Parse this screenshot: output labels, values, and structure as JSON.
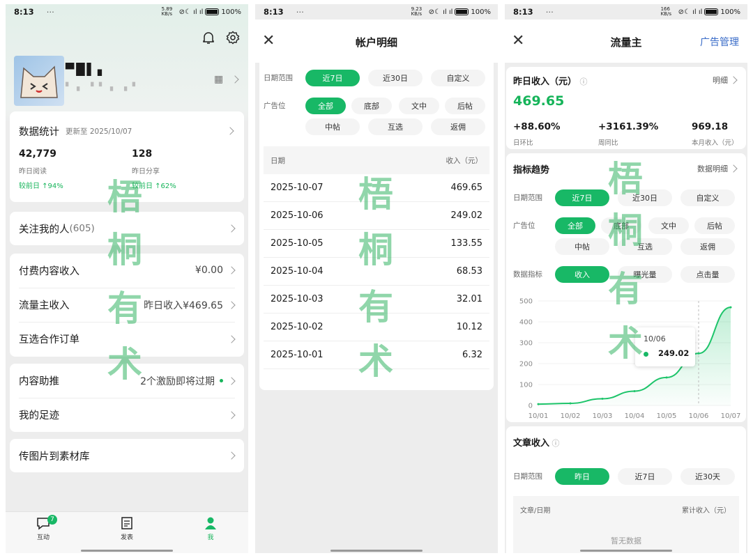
{
  "status": {
    "time": "8:13",
    "dots": "⋯",
    "net1": "5.89 KB/s",
    "net2": "9.23 KB/s",
    "net3": "166 KB/s",
    "battery": "100%"
  },
  "profile": {
    "name": "▀█▌▖",
    "subtext": "▘ ▖ ▝ ▘ ▖ ▗ ▘"
  },
  "stats": {
    "title": "数据统计",
    "updated": "更新至 2025/10/07",
    "reads": {
      "value": "42,779",
      "label": "昨日阅读",
      "change": "较前日 ↑94%"
    },
    "shares": {
      "value": "128",
      "label": "昨日分享",
      "change": "较前日 ↑62%"
    }
  },
  "followers": {
    "label": "关注我的人",
    "count": "(605)"
  },
  "menu": {
    "paid": {
      "label": "付费内容收入",
      "value": "¥0.00"
    },
    "traffic": {
      "label": "流量主收入",
      "value": "昨日收入¥469.65"
    },
    "mutual": {
      "label": "互选合作订单"
    },
    "assist": {
      "label": "内容助推",
      "value": "2个激励即将过期"
    },
    "footprint": {
      "label": "我的足迹"
    },
    "upload": {
      "label": "传图片到素材库"
    }
  },
  "nav": {
    "interact": "互动",
    "badge": "7",
    "post": "发表",
    "me": "我"
  },
  "watermark": {
    "c1": "梧",
    "c2": "桐",
    "c3": "有",
    "c4": "术"
  },
  "account": {
    "title": "帐户明细",
    "date_range_label": "日期范围",
    "date_opts": [
      "近7日",
      "近30日",
      "自定义"
    ],
    "ad_label": "广告位",
    "ad_opts": [
      "全部",
      "底部",
      "文中",
      "后帖",
      "中帖",
      "互选",
      "返佣"
    ],
    "col_date": "日期",
    "col_income": "收入（元）",
    "rows": [
      {
        "date": "2025-10-07",
        "amount": "469.65"
      },
      {
        "date": "2025-10-06",
        "amount": "249.02"
      },
      {
        "date": "2025-10-05",
        "amount": "133.55"
      },
      {
        "date": "2025-10-04",
        "amount": "68.53"
      },
      {
        "date": "2025-10-03",
        "amount": "32.01"
      },
      {
        "date": "2025-10-02",
        "amount": "10.12"
      },
      {
        "date": "2025-10-01",
        "amount": "6.32"
      }
    ]
  },
  "traffic": {
    "title": "流量主",
    "ad_manage": "广告管理",
    "yesterday_label": "昨日收入（元）",
    "detail": "明细",
    "yesterday_value": "469.65",
    "m1": {
      "value": "+88.60%",
      "label": "日环比"
    },
    "m2": {
      "value": "+3161.39%",
      "label": "周同比"
    },
    "m3": {
      "value": "969.18",
      "label": "本月收入（元）"
    },
    "trend_title": "指标趋势",
    "trend_detail": "数据明细",
    "date_label": "日期范围",
    "date_opts": [
      "近7日",
      "近30日",
      "自定义"
    ],
    "ad_label": "广告位",
    "ad_opts": [
      "全部",
      "底部",
      "文中",
      "后帖",
      "中帖",
      "互选",
      "返佣"
    ],
    "metric_label": "数据指标",
    "metric_opts": [
      "收入",
      "曝光量",
      "点击量"
    ],
    "tooltip_date": "10/06",
    "tooltip_value": "249.02",
    "article_title": "文章收入",
    "article_date_label": "日期范围",
    "article_opts": [
      "昨日",
      "近7日",
      "近30天"
    ],
    "article_col1": "文章/日期",
    "article_col2": "累计收入（元）",
    "empty": "暂无数据"
  },
  "chart_data": {
    "type": "area",
    "x": [
      "10/01",
      "10/02",
      "10/03",
      "10/04",
      "10/05",
      "10/06",
      "10/07"
    ],
    "series": [
      {
        "values": [
          6.32,
          10.12,
          32.01,
          68.53,
          133.55,
          249.02,
          469.65
        ]
      }
    ],
    "yticks": [
      0,
      100,
      200,
      300,
      400,
      500
    ],
    "ylim": [
      0,
      500
    ],
    "color": "#1dc46a"
  }
}
